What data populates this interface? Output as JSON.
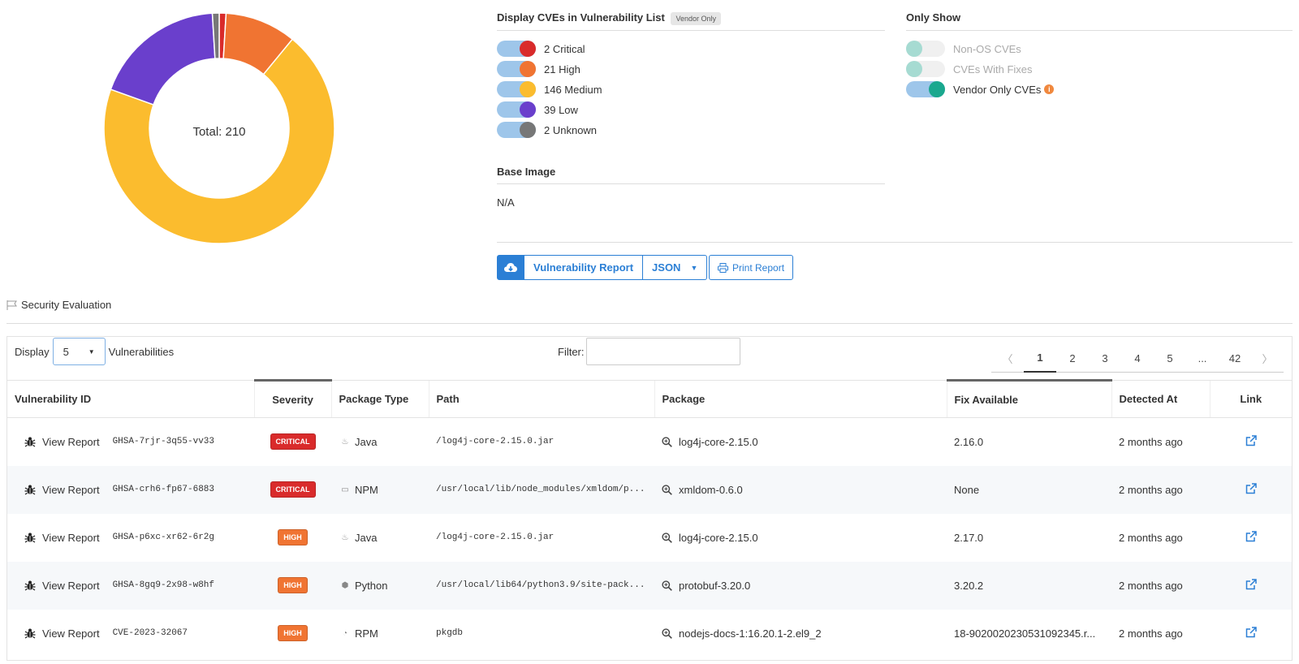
{
  "chart_data": {
    "type": "pie",
    "categories": [
      "Critical",
      "High",
      "Medium",
      "Low",
      "Unknown"
    ],
    "values": [
      2,
      21,
      146,
      39,
      2
    ],
    "colors": [
      "#d92b2b",
      "#f07432",
      "#fbbc2e",
      "#6a3fcc",
      "#777777"
    ],
    "center_label": "Total: 210"
  },
  "display_section": {
    "title": "Display CVEs in Vulnerability List",
    "tag": "Vendor Only",
    "toggles": [
      {
        "label": "2 Critical",
        "on": true,
        "color": "#d92b2b"
      },
      {
        "label": "21 High",
        "on": true,
        "color": "#f07432"
      },
      {
        "label": "146 Medium",
        "on": true,
        "color": "#fbbc2e"
      },
      {
        "label": "39 Low",
        "on": true,
        "color": "#6a3fcc"
      },
      {
        "label": "2 Unknown",
        "on": true,
        "color": "#777777"
      }
    ]
  },
  "base_image": {
    "title": "Base Image",
    "value": "N/A"
  },
  "only_show": {
    "title": "Only Show",
    "toggles": [
      {
        "label": "Non-OS CVEs",
        "on": false
      },
      {
        "label": "CVEs With Fixes",
        "on": false
      },
      {
        "label": "Vendor Only CVEs",
        "on": true
      }
    ]
  },
  "actions": {
    "report_label": "Vulnerability Report",
    "format_label": "JSON",
    "print_label": "Print Report"
  },
  "security_evaluation": "Security Evaluation",
  "table_controls": {
    "display_label": "Display",
    "display_value": "5",
    "vuln_label": "Vulnerabilities",
    "filter_label": "Filter:",
    "pages": [
      "1",
      "2",
      "3",
      "4",
      "5",
      "...",
      "42"
    ]
  },
  "columns": [
    "Vulnerability ID",
    "Severity",
    "Package Type",
    "Path",
    "Package",
    "Fix Available",
    "Detected At",
    "Link"
  ],
  "rows": [
    {
      "view": "View Report",
      "id": "GHSA-7rjr-3q55-vv33",
      "severity": "CRITICAL",
      "sev_color": "#d92b2b",
      "ptype": "Java",
      "path": "/log4j-core-2.15.0.jar",
      "package": "log4j-core-2.15.0",
      "fix": "2.16.0",
      "detected": "2 months ago"
    },
    {
      "view": "View Report",
      "id": "GHSA-crh6-fp67-6883",
      "severity": "CRITICAL",
      "sev_color": "#d92b2b",
      "ptype": "NPM",
      "path": "/usr/local/lib/node_modules/xmldom/p...",
      "package": "xmldom-0.6.0",
      "fix": "None",
      "detected": "2 months ago"
    },
    {
      "view": "View Report",
      "id": "GHSA-p6xc-xr62-6r2g",
      "severity": "HIGH",
      "sev_color": "#f07432",
      "ptype": "Java",
      "path": "/log4j-core-2.15.0.jar",
      "package": "log4j-core-2.15.0",
      "fix": "2.17.0",
      "detected": "2 months ago"
    },
    {
      "view": "View Report",
      "id": "GHSA-8gq9-2x98-w8hf",
      "severity": "HIGH",
      "sev_color": "#f07432",
      "ptype": "Python",
      "path": "/usr/local/lib64/python3.9/site-pack...",
      "package": "protobuf-3.20.0",
      "fix": "3.20.2",
      "detected": "2 months ago"
    },
    {
      "view": "View Report",
      "id": "CVE-2023-32067",
      "severity": "HIGH",
      "sev_color": "#f07432",
      "ptype": "RPM",
      "path": "pkgdb",
      "package": "nodejs-docs-1:16.20.1-2.el9_2",
      "fix": "18-9020020230531092345.r...",
      "detected": "2 months ago"
    }
  ]
}
